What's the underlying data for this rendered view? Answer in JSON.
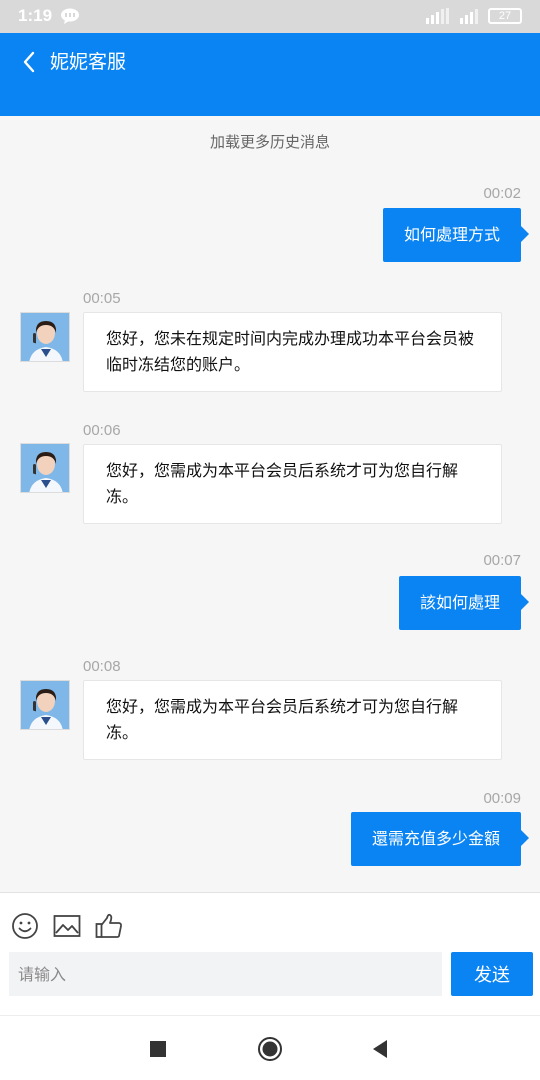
{
  "status_bar": {
    "time": "1:19",
    "battery": "27"
  },
  "header": {
    "title": "妮妮客服",
    "back_icon": "chevron-left-icon"
  },
  "chat": {
    "load_more": "加载更多历史消息",
    "messages": [
      {
        "side": "right",
        "time": "00:02",
        "text": "如何處理方式"
      },
      {
        "side": "left",
        "time": "00:05",
        "text": "您好，您未在规定时间内完成办理成功本平台会员被临时冻结您的账户。"
      },
      {
        "side": "left",
        "time": "00:06",
        "text": "您好，您需成为本平台会员后系统才可为您自行解冻。"
      },
      {
        "side": "right",
        "time": "00:07",
        "text": "該如何處理"
      },
      {
        "side": "left",
        "time": "00:08",
        "text": "您好，您需成为本平台会员后系统才可为您自行解冻。"
      },
      {
        "side": "right",
        "time": "00:09",
        "text": "還需充值多少金額"
      }
    ]
  },
  "composer": {
    "placeholder": "请输入",
    "send_label": "发送",
    "tools": [
      "emoji-icon",
      "image-icon",
      "thumbs-up-icon"
    ]
  },
  "colors": {
    "accent": "#0b84f3",
    "background": "#f6f6f6",
    "status_bar": "#d9d9d9"
  }
}
